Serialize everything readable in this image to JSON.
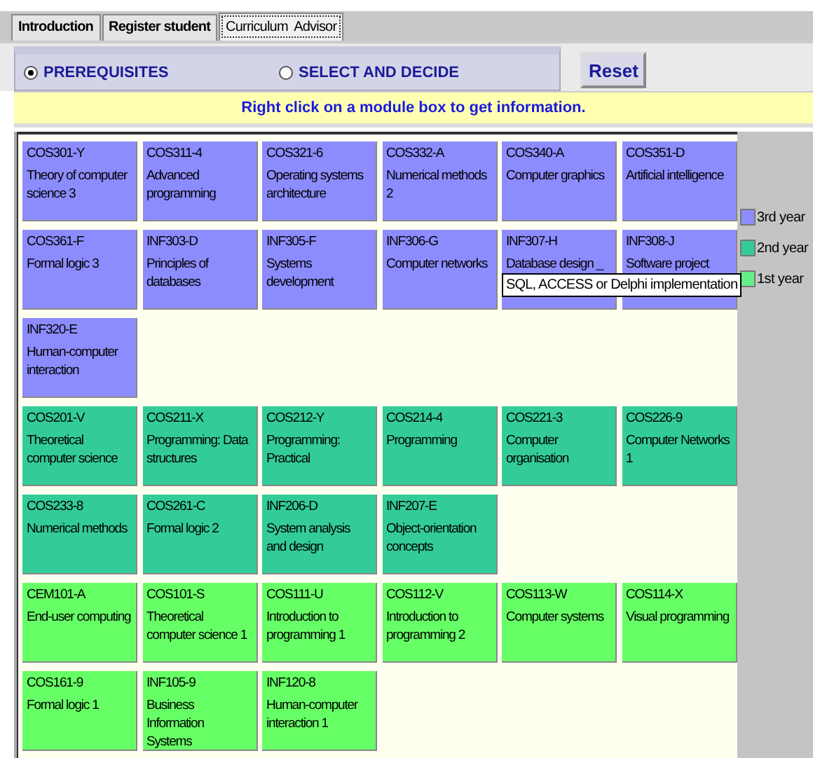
{
  "tabs": [
    {
      "label": "Introduction",
      "selected": false
    },
    {
      "label": "Register student",
      "selected": false
    },
    {
      "label": "Curriculum  Advisor",
      "selected": true
    }
  ],
  "modes": [
    {
      "label": "PREREQUISITES",
      "selected": true
    },
    {
      "label": "SELECT AND DECIDE",
      "selected": false
    }
  ],
  "reset_button": "Reset",
  "info_bar": "Right click on a module box to get information.",
  "module_groups": [
    {
      "color": "#8c8cff",
      "modules": [
        {
          "code": "COS301-Y",
          "title": "Theory of computer science 3"
        },
        {
          "code": "COS311-4",
          "title": "Advanced programming"
        },
        {
          "code": "COS321-6",
          "title": "Operating systems architecture"
        },
        {
          "code": "COS332-A",
          "title": "Numerical methods 2"
        },
        {
          "code": "COS340-A",
          "title": "Computer graphics"
        },
        {
          "code": "COS351-D",
          "title": "Artificial intelligence"
        },
        {
          "code": "COS361-F",
          "title": "Formal logic 3"
        },
        {
          "code": "INF303-D",
          "title": "Principles of databases"
        },
        {
          "code": "INF305-F",
          "title": "Systems development"
        },
        {
          "code": "INF306-G",
          "title": "Computer networks"
        },
        {
          "code": "INF307-H",
          "title": "Database design _"
        },
        {
          "code": "INF308-J",
          "title": "Software project"
        },
        {
          "code": "INF320-E",
          "title": "Human-computer interaction"
        }
      ]
    },
    {
      "color": "#33cc99",
      "modules": [
        {
          "code": "COS201-V",
          "title": "Theoretical computer science"
        },
        {
          "code": "COS211-X",
          "title": "Programming: Data structures"
        },
        {
          "code": "COS212-Y",
          "title": "Programming: Practical"
        },
        {
          "code": "COS214-4",
          "title": "Programming"
        },
        {
          "code": "COS221-3",
          "title": "Computer organisation"
        },
        {
          "code": "COS226-9",
          "title": "Computer Networks 1"
        },
        {
          "code": "COS233-8",
          "title": "Numerical methods"
        },
        {
          "code": "COS261-C",
          "title": "Formal logic 2"
        },
        {
          "code": "INF206-D",
          "title": "System analysis and design"
        },
        {
          "code": "INF207-E",
          "title": "Object-orientation concepts"
        }
      ]
    },
    {
      "color": "#66ff66",
      "modules": [
        {
          "code": "CEM101-A",
          "title": "End-user computing"
        },
        {
          "code": "COS101-S",
          "title": "Theoretical computer science 1"
        },
        {
          "code": "COS111-U",
          "title": "Introduction to programming 1"
        },
        {
          "code": "COS112-V",
          "title": "Introduction to programming 2"
        },
        {
          "code": "COS113-W",
          "title": "Computer systems"
        },
        {
          "code": "COS114-X",
          "title": "Visual programming"
        },
        {
          "code": "COS161-9",
          "title": "Formal logic 1"
        },
        {
          "code": "INF105-9",
          "title": "Business Information Systems"
        },
        {
          "code": "INF120-8",
          "title": "Human-computer interaction 1"
        }
      ]
    }
  ],
  "tooltip": "SQL, ACCESS or Delphi implementation",
  "legend": [
    {
      "label": "3rd year",
      "color": "#8c8cff"
    },
    {
      "label": "2nd year",
      "color": "#33cc99"
    },
    {
      "label": "1st year",
      "color": "#66ee88"
    }
  ]
}
